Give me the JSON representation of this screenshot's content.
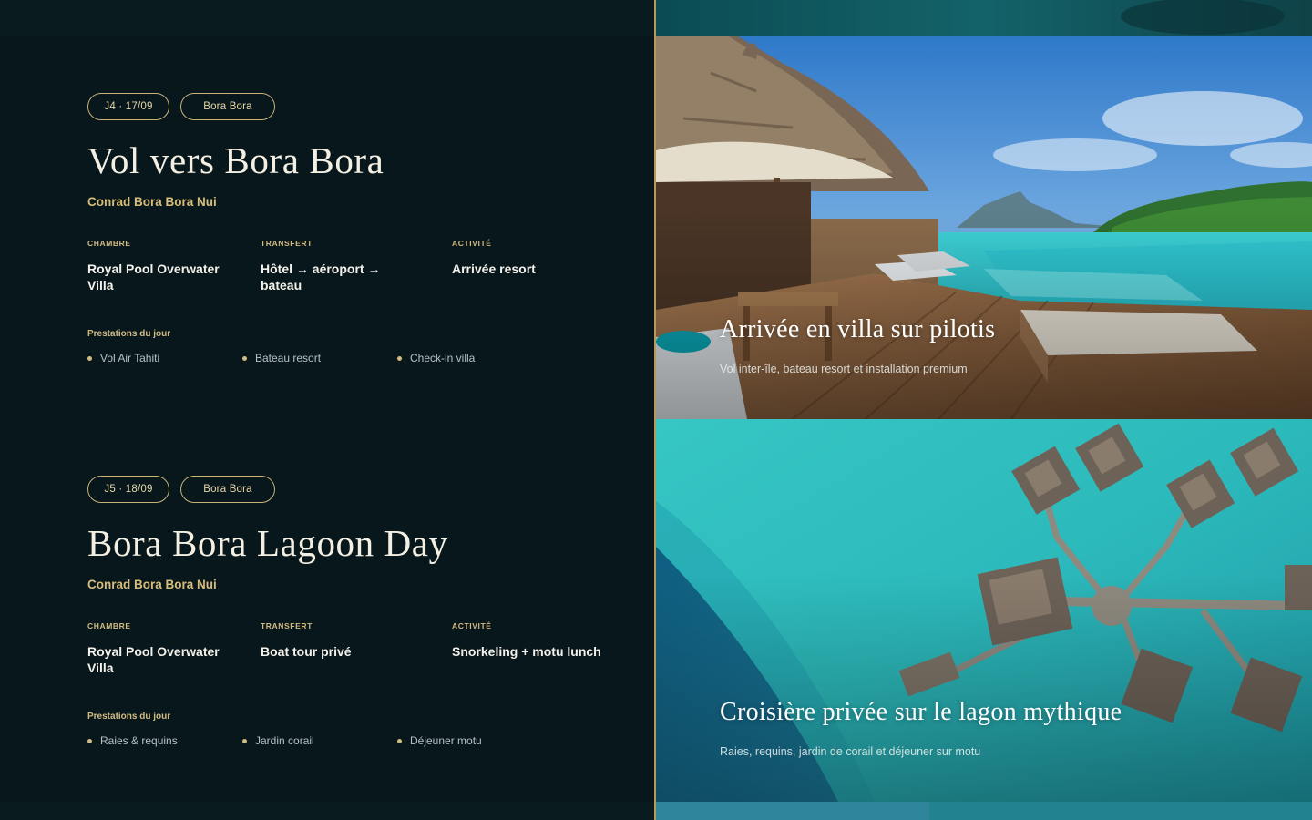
{
  "days": [
    {
      "date_tag": "J4 · 17/09",
      "location_tag": "Bora Bora",
      "title": "Vol vers Bora Bora",
      "hotel": "Conrad Bora Bora Nui",
      "room_label": "CHAMBRE",
      "room_value": "Royal Pool Overwater Villa",
      "transfer_label": "TRANSFERT",
      "transfer_value": "Hôtel → aéroport → bateau",
      "activity_label": "ACTIVITÉ",
      "activity_value": "Arrivée resort",
      "services_label": "Prestations du jour",
      "services": [
        "Vol Air Tahiti",
        "Bateau resort",
        "Check-in villa"
      ],
      "photo_title": "Arrivée en villa sur pilotis",
      "photo_subtitle": "Vol inter-île, bateau resort et installation premium"
    },
    {
      "date_tag": "J5 · 18/09",
      "location_tag": "Bora Bora",
      "title": "Bora Bora Lagoon Day",
      "hotel": "Conrad Bora Bora Nui",
      "room_label": "CHAMBRE",
      "room_value": "Royal Pool Overwater Villa",
      "transfer_label": "TRANSFERT",
      "transfer_value": "Boat tour privé",
      "activity_label": "ACTIVITÉ",
      "activity_value": "Snorkeling + motu lunch",
      "services_label": "Prestations du jour",
      "services": [
        "Raies & requins",
        "Jardin corail",
        "Déjeuner motu"
      ],
      "photo_title": "Croisière privée sur le lagon mythique",
      "photo_subtitle": "Raies, requins, jardin de corail et déjeuner sur motu"
    }
  ],
  "colors": {
    "background": "#08171c",
    "accent_gold": "#d2bb82",
    "divider": "#b9995a",
    "lagoon": "#2ec3c7"
  },
  "icons": [
    "bullet-dot"
  ]
}
